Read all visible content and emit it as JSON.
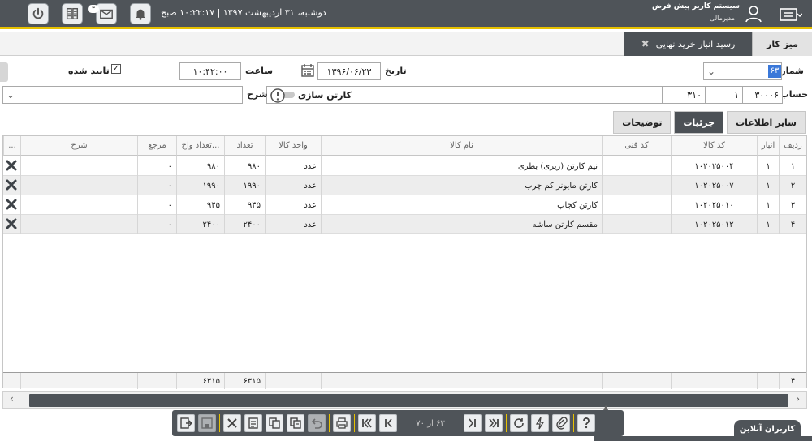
{
  "header": {
    "datetime": "دوشنبه، ۳۱ اردیبهشت ۱۳۹۷ | ۱۰:۲۲:۱۷ صبح",
    "message_badge": "۳",
    "system_name": "سیستم کاربر پیش فرض",
    "role": "مدیرمالی"
  },
  "tabs": {
    "desk": "میز کار",
    "active": "رسید انبار خرید نهایی"
  },
  "form": {
    "number_label": "شماره",
    "number_value": "۶۳",
    "date_label": "تاریخ",
    "date_value": "۱۳۹۶/۰۶/۲۳",
    "time_label": "ساعت",
    "time_value": "۱۰:۴۲:۰۰",
    "approved_label": "تایید شده",
    "account_label": "حساب",
    "account_code": "۳۰۰۰۶",
    "account_sub": "۱",
    "account_group": "۳۱۰",
    "account_name": "کارتن سازی",
    "desc_label": "شرح",
    "desc_value": ""
  },
  "detail_tabs": [
    "سایر اطلاعات",
    "جزئیات",
    "توضیحات"
  ],
  "grid": {
    "columns": [
      "ردیف",
      "انبار",
      "کد کالا",
      "کد فنی",
      "نام کالا",
      "واحد کالا",
      "تعداد",
      "تعداد واح...",
      "مرجع",
      "شرح",
      "..."
    ],
    "rows": [
      {
        "row": "۱",
        "store": "۱",
        "code": "۱۰۲۰۲۵۰۰۴",
        "tech": "",
        "name": "نیم کارتن (زیری) بطری",
        "unit": "عدد",
        "qty": "۹۸۰",
        "unit_qty": "۹۸۰",
        "ref": "۰",
        "desc": ""
      },
      {
        "row": "۲",
        "store": "۱",
        "code": "۱۰۲۰۲۵۰۰۷",
        "tech": "",
        "name": "کارتن مایونز کم چرب",
        "unit": "عدد",
        "qty": "۱۹۹۰",
        "unit_qty": "۱۹۹۰",
        "ref": "۰",
        "desc": ""
      },
      {
        "row": "۳",
        "store": "۱",
        "code": "۱۰۲۰۲۵۰۱۰",
        "tech": "",
        "name": "کارتن کچاپ",
        "unit": "عدد",
        "qty": "۹۴۵",
        "unit_qty": "۹۴۵",
        "ref": "۰",
        "desc": ""
      },
      {
        "row": "۴",
        "store": "۱",
        "code": "۱۰۲۰۲۵۰۱۲",
        "tech": "",
        "name": "مقسم کارتن ساشه",
        "unit": "عدد",
        "qty": "۲۴۰۰",
        "unit_qty": "۲۴۰۰",
        "ref": "۰",
        "desc": ""
      }
    ],
    "footer": {
      "count": "۴",
      "qty_total": "۶۳۱۵",
      "unit_qty_total": "۶۳۱۵"
    }
  },
  "toolbar": {
    "pager": "۶۳ از ۷۰"
  },
  "online_users": "کاربران آنلاین",
  "colors": {
    "header_bg": "#4f5459",
    "accent": "#e7c100",
    "active_tab": "#4c5156",
    "selection": "#3a78d9"
  }
}
